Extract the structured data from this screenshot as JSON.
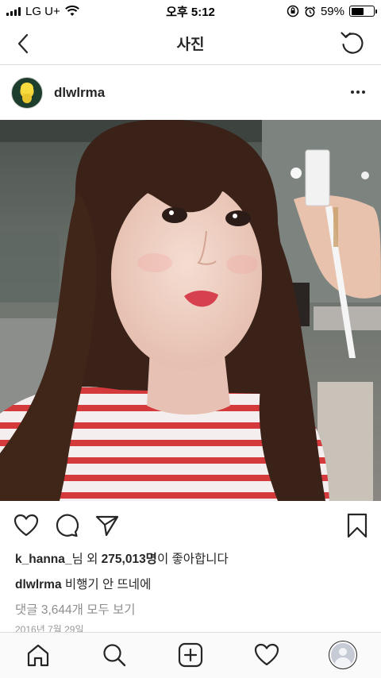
{
  "status_bar": {
    "carrier": "LG U+",
    "time": "오후 5:12",
    "battery_percent": "59%",
    "battery_level": 0.59,
    "icons": [
      "signal-icon",
      "wifi-icon",
      "rotation-lock-icon",
      "alarm-icon",
      "battery-icon"
    ]
  },
  "nav": {
    "title": "사진",
    "back_icon": "chevron-left-icon",
    "refresh_icon": "refresh-icon"
  },
  "post": {
    "username": "dlwlrma",
    "more_icon": "more-horizontal-icon",
    "likes": {
      "user": "k_hanna_",
      "middle": "님 외 ",
      "count": "275,013명",
      "suffix": "이 좋아합니다"
    },
    "caption": {
      "username": "dlwlrma",
      "text": "비행기 안 뜨네에"
    },
    "comments_link": "댓글 3,644개 모두 보기",
    "date": "2016년 7월 29일",
    "actions": [
      "heart-icon",
      "comment-icon",
      "share-icon",
      "bookmark-icon"
    ]
  },
  "tab_bar": {
    "items": [
      "home-icon",
      "search-icon",
      "add-post-icon",
      "activity-heart-icon",
      "profile-avatar"
    ]
  },
  "colors": {
    "text": "#262626",
    "muted": "#8e8e8e",
    "divider": "#dbdbdb",
    "tab_bg": "#fafafa"
  }
}
